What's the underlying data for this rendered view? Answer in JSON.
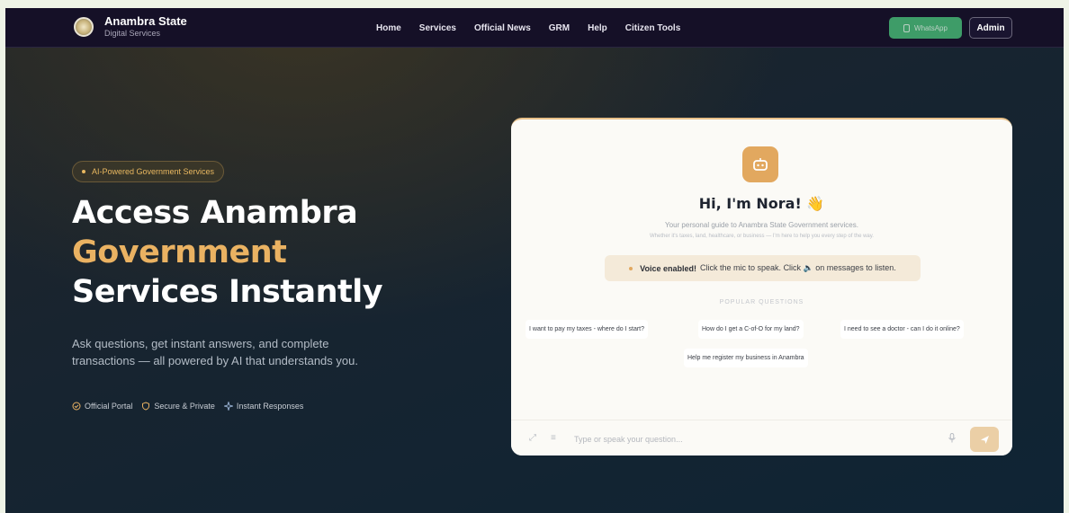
{
  "nav": {
    "brand_title": "Anambra State",
    "brand_subtitle": "Digital Services",
    "links": [
      "Home",
      "Services",
      "Official News",
      "GRM",
      "Help",
      "Citizen Tools"
    ],
    "whatsapp_label": "WhatsApp",
    "admin_label": "Admin"
  },
  "hero": {
    "badge": "AI-Powered Government Services",
    "title_line1": "Access Anambra",
    "title_line2": "Government",
    "title_line3": "Services Instantly",
    "subtitle": "Ask questions, get instant answers, and complete transactions — all powered by AI that understands you.",
    "features": [
      "Official Portal",
      "Secure & Private",
      "Instant Responses"
    ]
  },
  "chat": {
    "greeting": "Hi, I'm Nora! 👋",
    "description": "Your personal guide to Anambra State Government services.",
    "description2": "Whether it's taxes, land, healthcare, or business — I'm here to help you every step of the way.",
    "voice_bold": "Voice enabled!",
    "voice_text": "Click the mic to speak. Click 🔈 on messages to listen.",
    "popular_label": "POPULAR QUESTIONS",
    "questions": [
      "I want to pay my taxes - where do I start?",
      "How do I get a C-of-O for my land?",
      "I need to see a doctor - can I do it online?",
      "Help me register my business in Anambra"
    ],
    "input_placeholder": "Type or speak your question..."
  },
  "colors": {
    "accent": "#eab262",
    "nav_bg": "#151027",
    "whatsapp": "#46b574"
  }
}
